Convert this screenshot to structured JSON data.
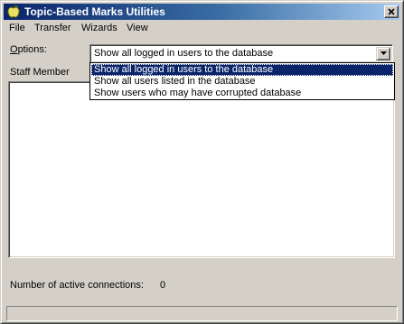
{
  "window": {
    "title": "Topic-Based Marks Utilities",
    "icon": "apple-icon"
  },
  "menubar": {
    "items": [
      {
        "label": "File"
      },
      {
        "label": "Transfer"
      },
      {
        "label": "Wizards"
      },
      {
        "label": "View"
      }
    ]
  },
  "options": {
    "label_prefix": "O",
    "label_rest": "ptions:",
    "selected": "Show all logged in users to the database",
    "dropdown_open": true,
    "items": [
      {
        "label": "Show all logged in users to the database",
        "selected": true
      },
      {
        "label": "Show all users listed in the database",
        "selected": false
      },
      {
        "label": "Show users who may have corrupted database",
        "selected": false
      }
    ]
  },
  "staff_list": {
    "header": "Staff Member",
    "rows": []
  },
  "connections": {
    "label": "Number of active connections:",
    "value": "0"
  },
  "colors": {
    "title_start": "#0a246a",
    "title_end": "#a6caf0",
    "face": "#d4d0c8",
    "selection": "#0a246a"
  }
}
